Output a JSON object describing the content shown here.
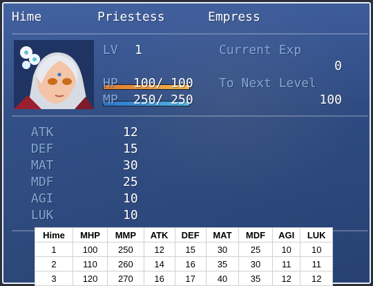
{
  "actor": {
    "name": "Hime",
    "class": "Priestess",
    "nickname": "Empress"
  },
  "status": {
    "level_label": "LV",
    "level": "1",
    "hp_label": "HP",
    "hp_text": "100/ 100",
    "hp_fraction": 1,
    "mp_label": "MP",
    "mp_text": "250/ 250",
    "mp_fraction": 1,
    "exp_label": "Current Exp",
    "exp_value": "0",
    "next_label": "To Next Level",
    "next_value": "100"
  },
  "params": [
    {
      "label": "ATK",
      "value": "12"
    },
    {
      "label": "DEF",
      "value": "15"
    },
    {
      "label": "MAT",
      "value": "30"
    },
    {
      "label": "MDF",
      "value": "25"
    },
    {
      "label": "AGI",
      "value": "10"
    },
    {
      "label": "LUK",
      "value": "10"
    }
  ],
  "colors": {
    "window": "#2f4d85",
    "system_text": "#84a7d8",
    "hp_gauge": "#e07a2f",
    "mp_gauge": "#2a74c9"
  },
  "stat_table": {
    "headers": [
      "Hime",
      "MHP",
      "MMP",
      "ATK",
      "DEF",
      "MAT",
      "MDF",
      "AGI",
      "LUK"
    ],
    "rows": [
      [
        "1",
        "100",
        "250",
        "12",
        "15",
        "30",
        "25",
        "10",
        "10"
      ],
      [
        "2",
        "110",
        "260",
        "14",
        "16",
        "35",
        "30",
        "11",
        "11"
      ],
      [
        "3",
        "120",
        "270",
        "16",
        "17",
        "40",
        "35",
        "12",
        "12"
      ]
    ]
  }
}
